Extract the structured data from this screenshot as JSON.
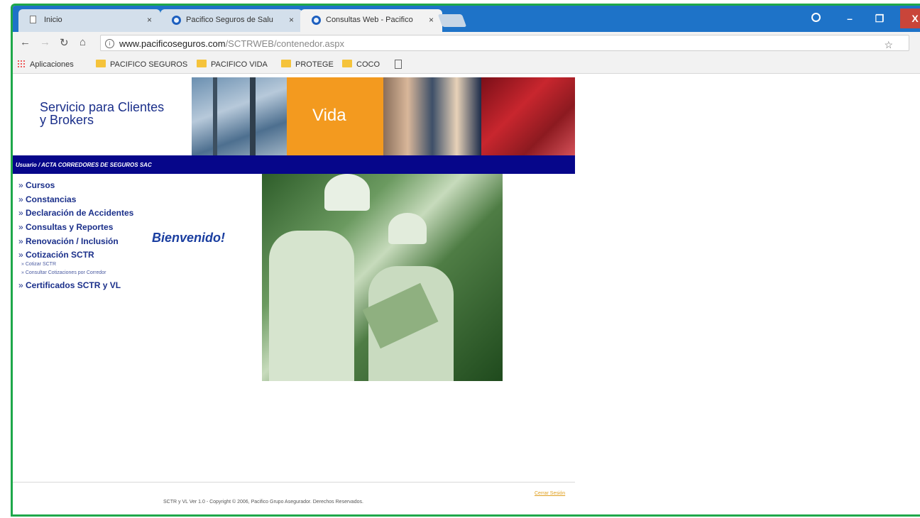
{
  "browser": {
    "tabs": [
      {
        "title": "Inicio",
        "icon": "doc-icon"
      },
      {
        "title": "Pacifico Seguros de Salu",
        "icon": "globe-icon"
      },
      {
        "title": "Consultas Web - Pacifico",
        "icon": "globe-icon"
      }
    ],
    "url_host": "www.pacificoseguros.com",
    "url_path": "/SCTRWEB/contenedor.aspx",
    "window_buttons": {
      "minimize": "–",
      "restore": "❐",
      "close": "X"
    },
    "close_tab_glyph": "×"
  },
  "bookmarks": {
    "apps": "Aplicaciones",
    "items": [
      "PACIFICO SEGUROS",
      "PACIFICO VIDA",
      "PROTEGE",
      "COCO"
    ]
  },
  "site": {
    "brand": "Servicio para Clientes\ny Brokers",
    "banner_label": "Vida",
    "user_bar": "Usuario / ACTA CORREDORES DE SEGUROS SAC",
    "welcome": "Bienvenido!",
    "menu": [
      "Cursos",
      "Constancias",
      "Declaración de Accidentes",
      "Consultas y Reportes",
      "Renovación / Inclusión",
      "Cotización SCTR"
    ],
    "submenu": [
      "Cotizar SCTR",
      "Consultar Cotizaciones por Corredor"
    ],
    "menu_last": "Certificados SCTR y VL",
    "copyright": "SCTR y VL Ver 1.0 - Copyright © 2006, Pacifico Grupo Asegurador. Derechos Reservados.",
    "logout": "Cerrar Sesión"
  },
  "colors": {
    "frame_border": "#1fa84a",
    "tabstrip": "#1e73c8",
    "user_bar": "#06068a",
    "vida_orange": "#f39a1f",
    "link_blue": "#1a2f8a"
  }
}
